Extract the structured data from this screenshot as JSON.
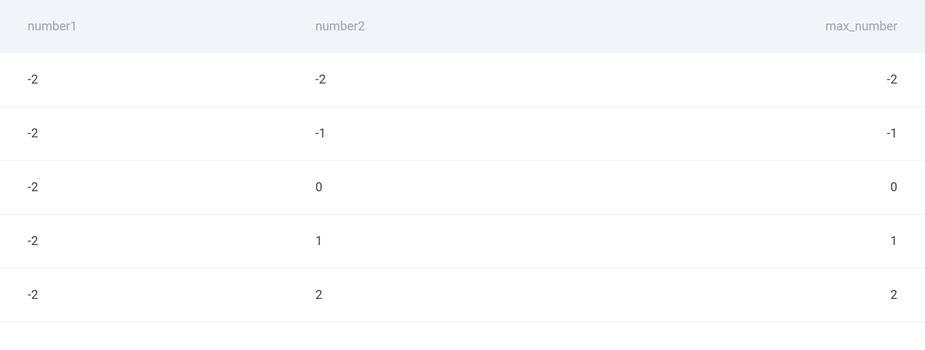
{
  "chart_data": {
    "type": "table",
    "columns": [
      "number1",
      "number2",
      "max_number"
    ],
    "rows": [
      [
        -2,
        -2,
        -2
      ],
      [
        -2,
        -1,
        -1
      ],
      [
        -2,
        0,
        0
      ],
      [
        -2,
        1,
        1
      ],
      [
        -2,
        2,
        2
      ]
    ]
  },
  "headers": {
    "col0": "number1",
    "col1": "number2",
    "col2": "max_number"
  },
  "rows": [
    {
      "col0": "-2",
      "col1": "-2",
      "col2": "-2"
    },
    {
      "col0": "-2",
      "col1": "-1",
      "col2": "-1"
    },
    {
      "col0": "-2",
      "col1": "0",
      "col2": "0"
    },
    {
      "col0": "-2",
      "col1": "1",
      "col2": "1"
    },
    {
      "col0": "-2",
      "col1": "2",
      "col2": "2"
    }
  ]
}
